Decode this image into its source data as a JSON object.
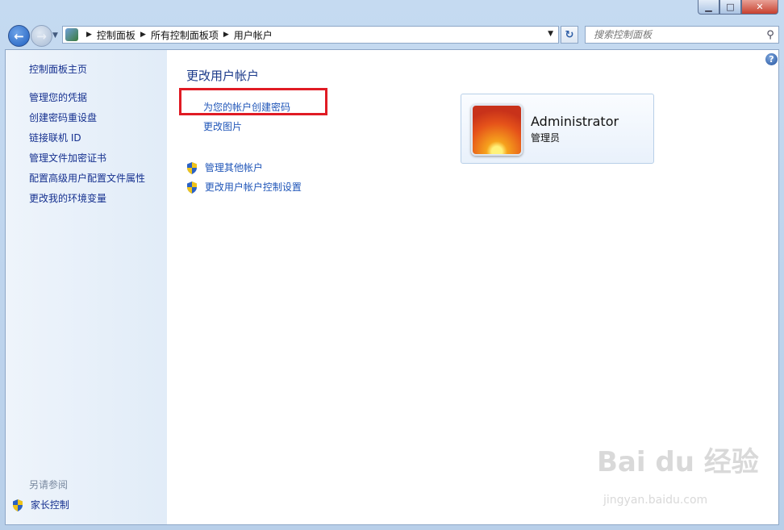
{
  "window": {
    "controls": {
      "minimize": "▁",
      "maximize": "□",
      "close": "✕"
    }
  },
  "address_bar": {
    "crumbs": [
      "控制面板",
      "所有控制面板项",
      "用户帐户"
    ],
    "search_placeholder": "搜索控制面板"
  },
  "sidebar": {
    "home": "控制面板主页",
    "items": [
      "管理您的凭据",
      "创建密码重设盘",
      "链接联机 ID",
      "管理文件加密证书",
      "配置高级用户配置文件属性",
      "更改我的环境变量"
    ],
    "see_also_header": "另请参阅",
    "see_also_items": [
      "家长控制"
    ]
  },
  "main": {
    "title": "更改用户帐户",
    "links": [
      "为您的帐户创建密码",
      "更改图片"
    ],
    "shield_links": [
      "管理其他帐户",
      "更改用户帐户控制设置"
    ]
  },
  "user": {
    "name": "Administrator",
    "role": "管理员"
  },
  "watermark": {
    "brand": "Bai du 经验",
    "url": "jingyan.baidu.com"
  },
  "colors": {
    "link": "#1f55b8",
    "highlight_box": "#e01b24",
    "sidebar_bg": "#e1ecf8"
  }
}
